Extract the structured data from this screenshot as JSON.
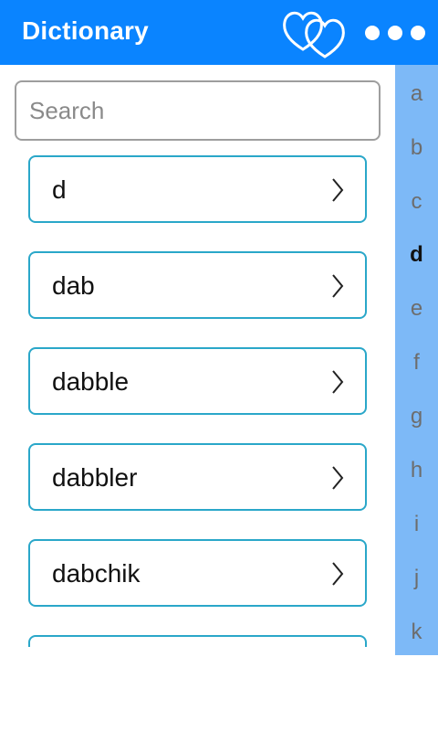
{
  "app": {
    "title": "Dictionary"
  },
  "search": {
    "placeholder": "Search",
    "value": ""
  },
  "words": [
    "d",
    "dab",
    "dabble",
    "dabbler",
    "dabchik",
    ""
  ],
  "alphabet": {
    "letters": [
      "a",
      "b",
      "c",
      "d",
      "e",
      "f",
      "g",
      "h",
      "i",
      "j",
      "k"
    ],
    "selected": "d"
  },
  "colors": {
    "appbar": "#0a84ff",
    "item_border": "#2aa7c9",
    "index_bar": "#7db9f7"
  }
}
